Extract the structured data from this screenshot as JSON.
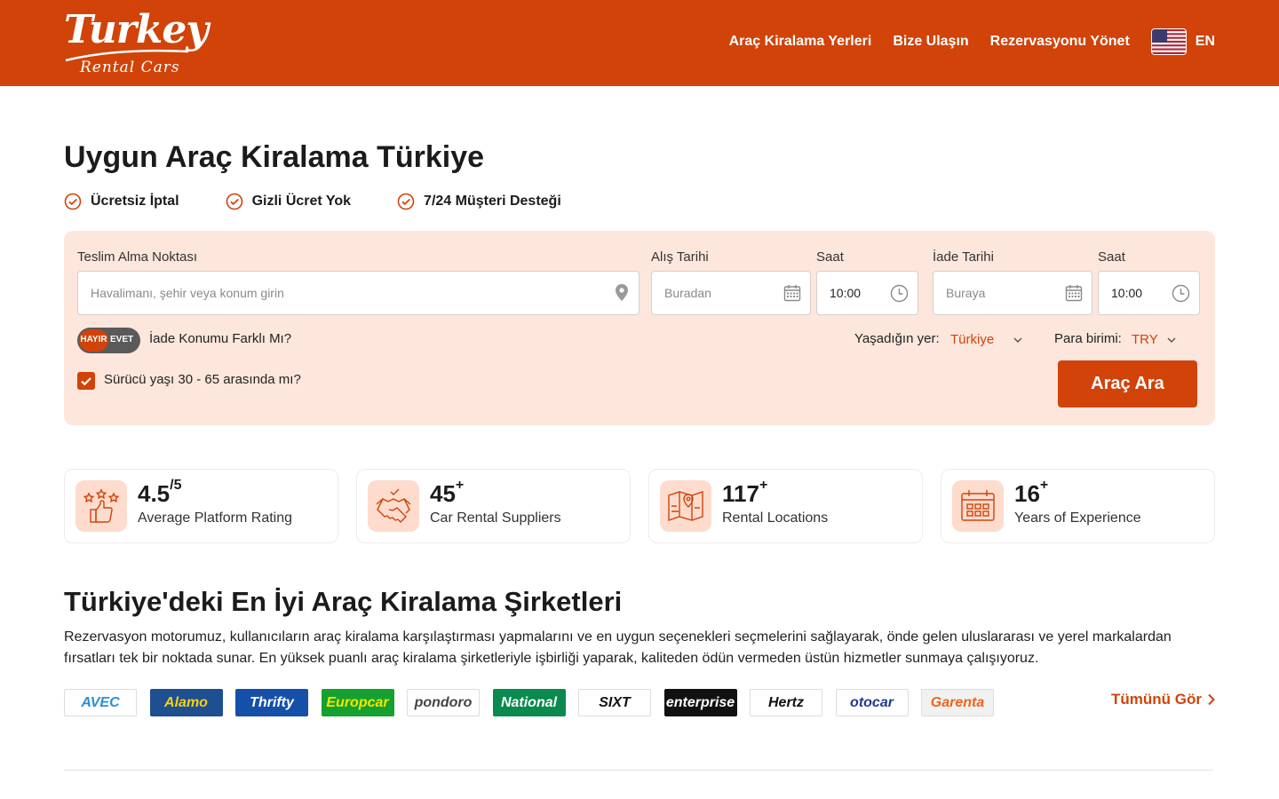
{
  "header": {
    "logo_main": "Turkey",
    "logo_sub": "Rental Cars",
    "nav": [
      "Araç Kiralama Yerleri",
      "Bize Ulaşın",
      "Rezervasyonu Yönet"
    ],
    "language": "EN",
    "brand_color": "#d14309"
  },
  "hero": {
    "title": "Uygun Araç Kiralama Türkiye",
    "features": [
      "Ücretsiz İptal",
      "Gizli Ücret Yok",
      "7/24 Müşteri Desteği"
    ]
  },
  "search": {
    "pickup_label": "Teslim Alma Noktası",
    "pickup_placeholder": "Havalimanı, şehir veya konum girin",
    "pickup_date_label": "Alış Tarihi",
    "pickup_date_placeholder": "Buradan",
    "pickup_time_label": "Saat",
    "pickup_time": "10:00",
    "return_date_label": "İade Tarihi",
    "return_date_placeholder": "Buraya",
    "return_time_label": "Saat",
    "return_time": "10:00",
    "toggle_no": "HAYIR",
    "toggle_yes": "EVET",
    "toggle_label": "İade Konumu Farklı Mı?",
    "residence_label": "Yaşadığın yer:",
    "residence_value": "Türkiye",
    "currency_label": "Para birimi:",
    "currency_value": "TRY",
    "age_label": "Sürücü yaşı 30 - 65 arasında mı?",
    "age_checked": true,
    "button": "Araç Ara"
  },
  "stats": [
    {
      "value": "4.5",
      "sup": "/5",
      "label": "Average Platform Rating",
      "icon": "rating-thumb-icon"
    },
    {
      "value": "45",
      "sup": "+",
      "label": "Car Rental Suppliers",
      "icon": "handshake-icon"
    },
    {
      "value": "117",
      "sup": "+",
      "label": "Rental Locations",
      "icon": "map-icon"
    },
    {
      "value": "16",
      "sup": "+",
      "label": "Years of Experience",
      "icon": "calendar-icon"
    }
  ],
  "companies": {
    "title": "Türkiye'deki En İyi Araç Kiralama Şirketleri",
    "description": "Rezervasyon motorumuz, kullanıcıların araç kiralama karşılaştırması yapmalarını ve en uygun seçenekleri seçmelerini sağlayarak, önde gelen uluslararası ve yerel markalardan fırsatları tek bir noktada sunar. En yüksek puanlı araç kiralama şirketleriyle işbirliği yaparak, kaliteden ödün vermeden üstün hizmetler sunmaya çalışıyoruz.",
    "brands": [
      {
        "name": "AVEC",
        "bg": "#ffffff",
        "fg": "#2a8fd6",
        "border": "#dddddd"
      },
      {
        "name": "Alamo",
        "bg": "#1d4f91",
        "fg": "#f7d117",
        "border": "#1d4f91"
      },
      {
        "name": "Thrifty",
        "bg": "#1550a8",
        "fg": "#ffffff",
        "border": "#1550a8"
      },
      {
        "name": "Europcar",
        "bg": "#15a130",
        "fg": "#f3e600",
        "border": "#15a130"
      },
      {
        "name": "pondoro",
        "bg": "#ffffff",
        "fg": "#444444",
        "border": "#dddddd"
      },
      {
        "name": "National",
        "bg": "#0a8a4c",
        "fg": "#ffffff",
        "border": "#0a8a4c"
      },
      {
        "name": "SIXT",
        "bg": "#ffffff",
        "fg": "#111111",
        "border": "#dddddd"
      },
      {
        "name": "enterprise",
        "bg": "#111111",
        "fg": "#ffffff",
        "border": "#111111"
      },
      {
        "name": "Hertz",
        "bg": "#ffffff",
        "fg": "#111111",
        "border": "#dddddd"
      },
      {
        "name": "otocar",
        "bg": "#ffffff",
        "fg": "#1d3b8f",
        "border": "#dddddd"
      },
      {
        "name": "Garenta",
        "bg": "#f1f1f1",
        "fg": "#f0621c",
        "border": "#dddddd"
      }
    ],
    "see_all": "Tümünü Gör"
  }
}
